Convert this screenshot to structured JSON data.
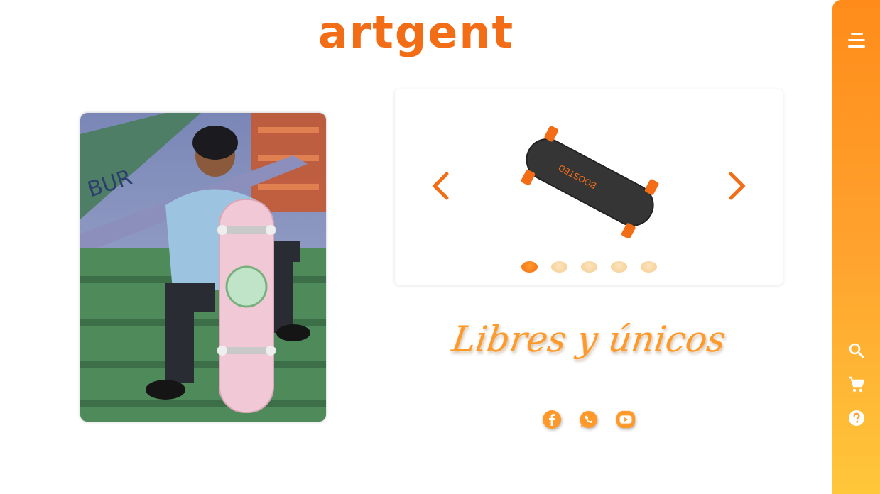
{
  "brand": {
    "logo_text": "artgent"
  },
  "colors": {
    "accent": "#f36d16",
    "accent_light": "#ff9a2a",
    "sidebar_top": "#ff8c1a",
    "sidebar_bottom": "#ffc73a"
  },
  "hero": {
    "image": "skater-with-pink-skateboard-photo"
  },
  "carousel": {
    "current_item": "longboard-product-image",
    "prev_icon": "chevron-left-icon",
    "next_icon": "chevron-right-icon",
    "slide_count": 5,
    "active_index": 0
  },
  "tagline": "Libres y únicos",
  "social": [
    {
      "name": "facebook",
      "icon": "facebook-icon"
    },
    {
      "name": "whatsapp",
      "icon": "whatsapp-icon"
    },
    {
      "name": "youtube",
      "icon": "youtube-icon"
    }
  ],
  "sidebar": {
    "menu_icon": "menu-icon",
    "actions": [
      {
        "name": "search",
        "icon": "search-icon"
      },
      {
        "name": "cart",
        "icon": "cart-icon"
      },
      {
        "name": "help",
        "icon": "help-icon"
      }
    ]
  }
}
